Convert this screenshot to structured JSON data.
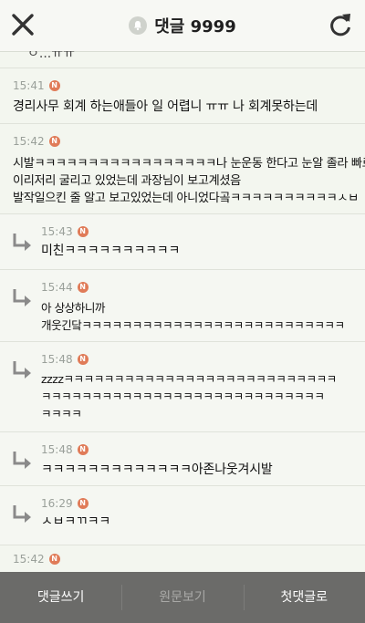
{
  "header": {
    "title": "댓글 9999"
  },
  "partial_top_text": "ㅇ...ㅠㅠ",
  "comments": [
    {
      "time": "15:41",
      "badge": "N",
      "text": "경리사무 회계 하는애들아 일 어렵니 ㅠㅠ 나 회계못하는데",
      "reply": false
    },
    {
      "time": "15:42",
      "badge": "N",
      "text": "시발ㅋㅋㅋㅋㅋㅋㅋㅋㅋㅋㅋㅋㅋㅋㅋㅋㅋ나 눈운동 한다고 눈알 졸라 빠르게\n이리저리 굴리고 있었는데 과장님이 보고계셨음\n발작일으킨 줄 알고 보고있었는데 아니었다곸ㅋㅋㅋㅋㅋㅋㅋㅋㅋㅋㅅㅂ",
      "reply": false
    },
    {
      "time": "15:43",
      "badge": "N",
      "text": "미친ㅋㅋㅋㅋㅋㅋㅋㅋㅋㅋ",
      "reply": true
    },
    {
      "time": "15:44",
      "badge": "N",
      "text": "아 상상하니까\n개웃긴닼ㅋㅋㅋㅋㅋㅋㅋㅋㅋㅋㅋㅋㅋㅋㅋㅋㅋㅋㅋㅋㅋㅋㅋㅋㅋㅋ",
      "reply": true
    },
    {
      "time": "15:48",
      "badge": "N",
      "text": "zzzzㅋㅋㅋㅋㅋㅋㅋㅋㅋㅋㅋㅋㅋㅋㅋㅋㅋㅋㅋㅋㅋㅋㅋㅋㅋㅋㅋ\nㅋㅋㅋㅋㅋㅋㅋㅋㅋㅋㅋㅋㅋㅋㅋㅋㅋㅋㅋㅋㅋㅋㅋㅋㅋㅋㅋㅋ\nㅋㅋㅋㅋ",
      "reply": true
    },
    {
      "time": "15:48",
      "badge": "N",
      "text": "ㅋㅋㅋㅋㅋㅋㅋㅋㅋㅋㅋㅋㅋ아존나웃겨시발",
      "reply": true
    },
    {
      "time": "16:29",
      "badge": "N",
      "text": "ㅅㅂㅋㄲㅋㅋ",
      "reply": true
    }
  ],
  "peek_time": "15:42",
  "bottom_bar": {
    "write": "댓글쓰기",
    "original": "원문보기",
    "first": "첫댓글로"
  },
  "icons": {
    "close": "close-icon",
    "bell": "bell-icon",
    "refresh": "refresh-icon",
    "reply": "reply-arrow-icon"
  },
  "colors": {
    "badge": "#e07b58",
    "background": "#f3f6ef",
    "bottom_bar": "#6b6b69"
  }
}
